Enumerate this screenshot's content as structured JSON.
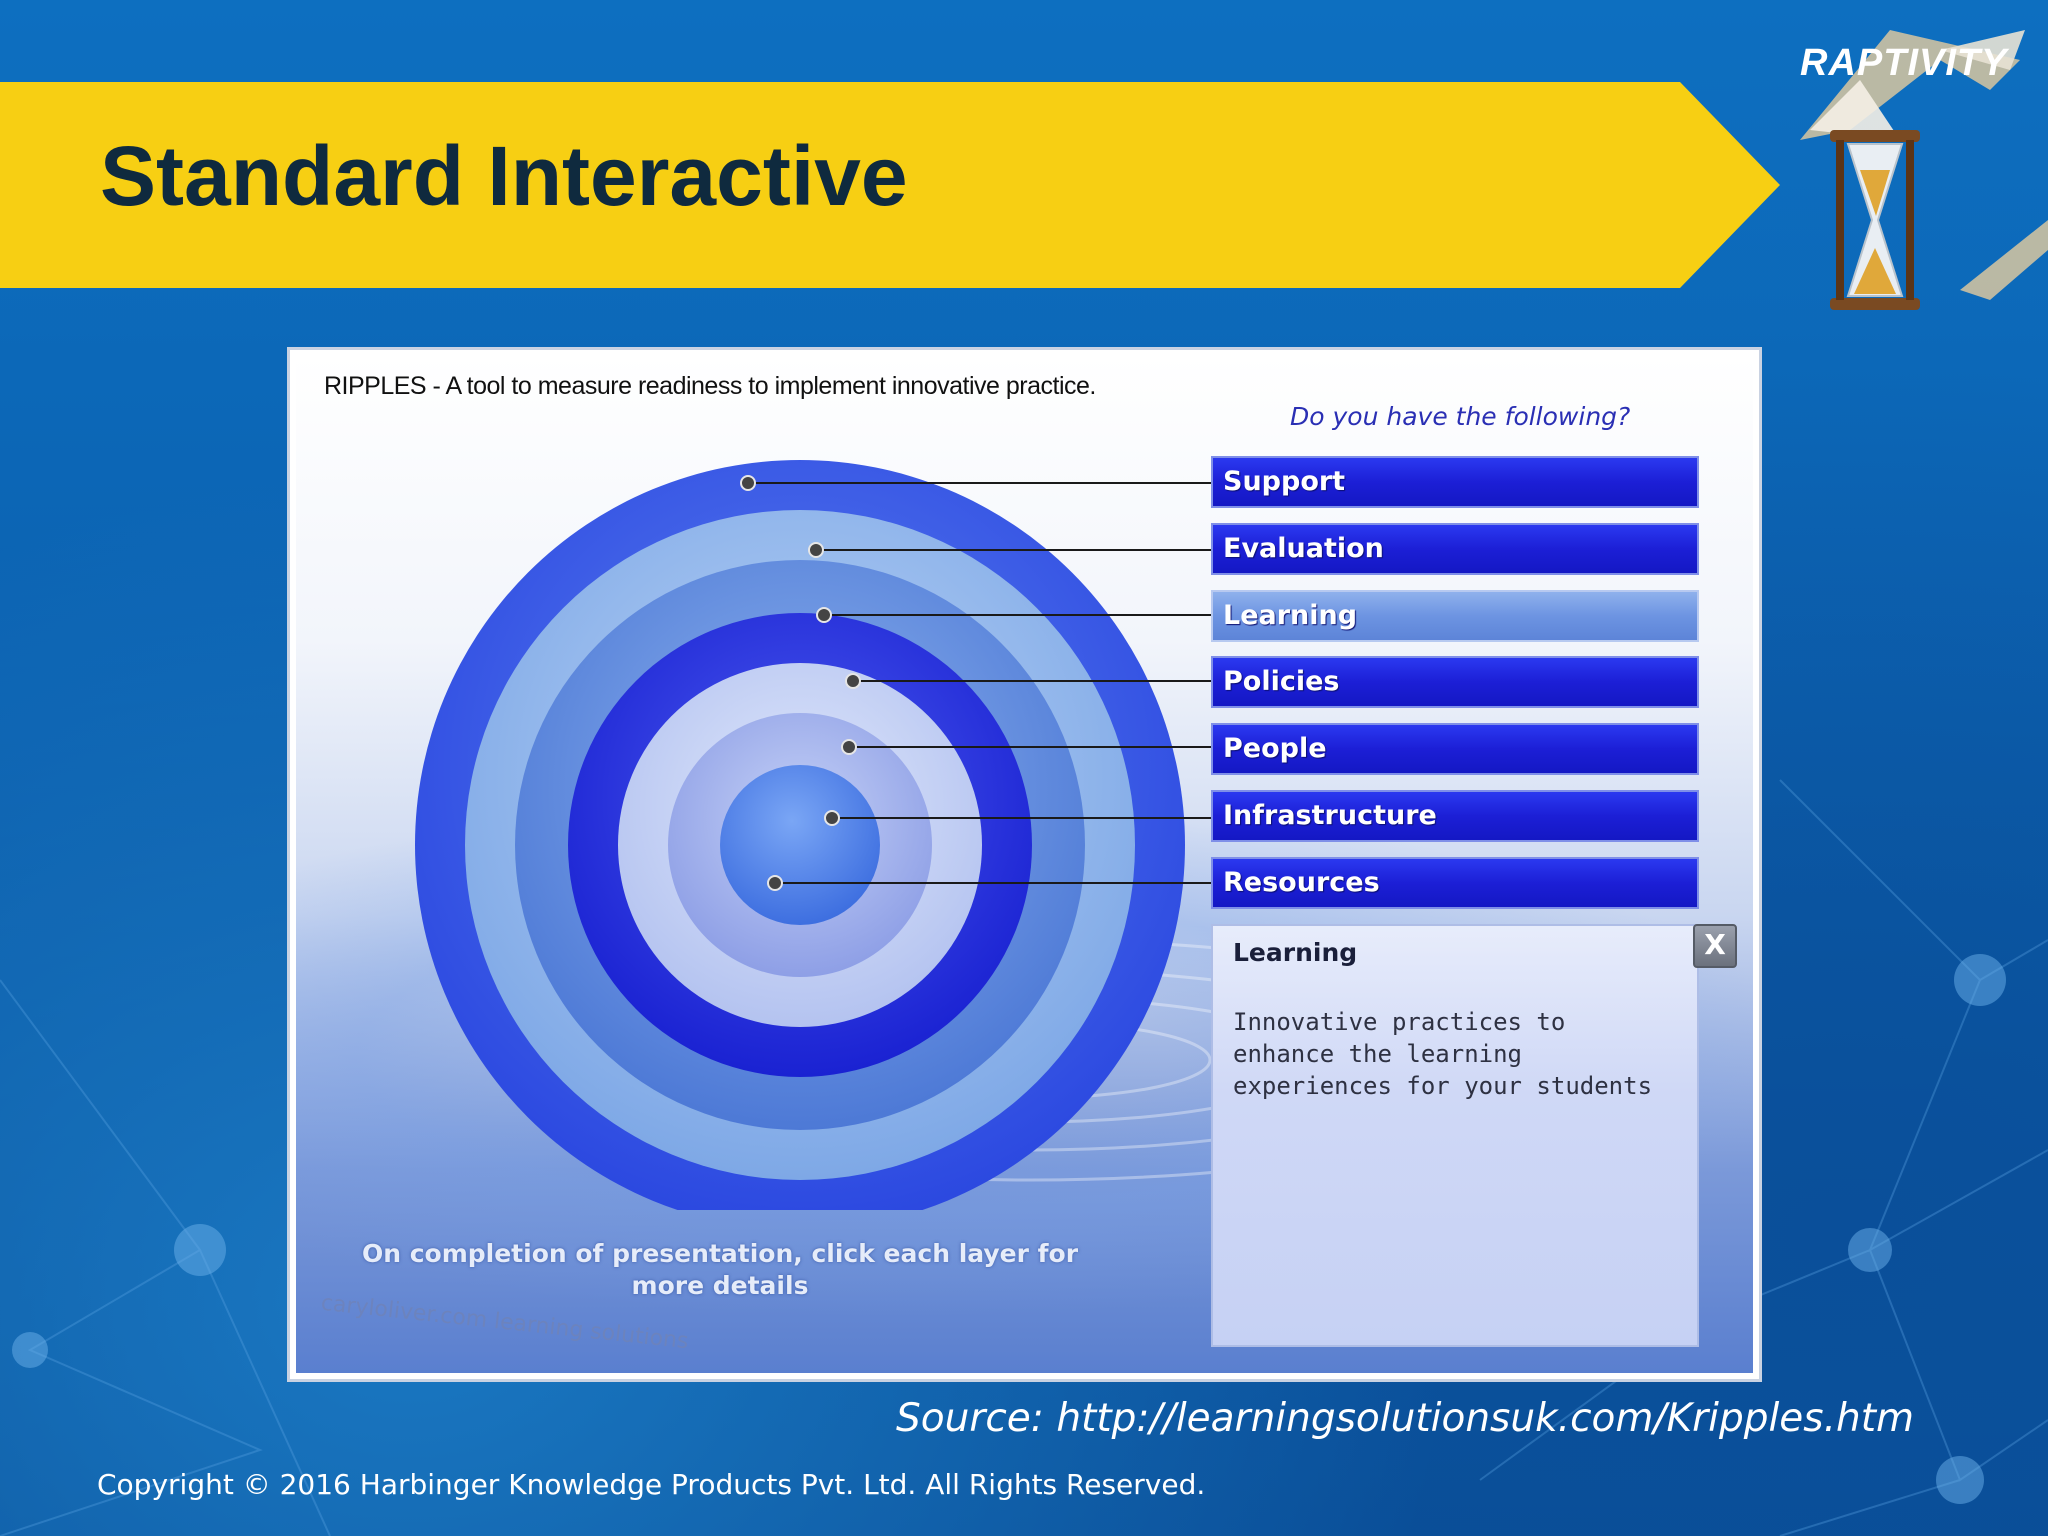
{
  "slide": {
    "title": "Standard Interactive",
    "source": "Source: http://learningsolutionsuk.com/Kripples.htm",
    "copyright": "Copyright © 2016 Harbinger Knowledge Products Pvt. Ltd. All Rights Reserved."
  },
  "logo": {
    "text": "RAPTIVITY",
    "icon": "hourglass-icon"
  },
  "app": {
    "header": "RIPPLES - A tool to measure readiness to implement innovative practice.",
    "question": "Do you have the following?",
    "layers": [
      {
        "label": "Support",
        "active": false
      },
      {
        "label": "Evaluation",
        "active": false
      },
      {
        "label": "Learning",
        "active": true
      },
      {
        "label": "Policies",
        "active": false
      },
      {
        "label": "People",
        "active": false
      },
      {
        "label": "Infrastructure",
        "active": false
      },
      {
        "label": "Resources",
        "active": false
      }
    ],
    "info_panel": {
      "title": "Learning",
      "body": "Innovative practices to enhance the learning experiences for your students",
      "close_label": "X"
    },
    "instruction": "On completion of presentation, click each layer for more details",
    "watermark": "caryloliver.com  learning solutions"
  },
  "colors": {
    "banner": "#f7cf13",
    "title_text": "#0f2a3e",
    "layer_button": "#1c1fd6",
    "layer_button_active": "#6d94e2",
    "background": "#0c62b1"
  }
}
